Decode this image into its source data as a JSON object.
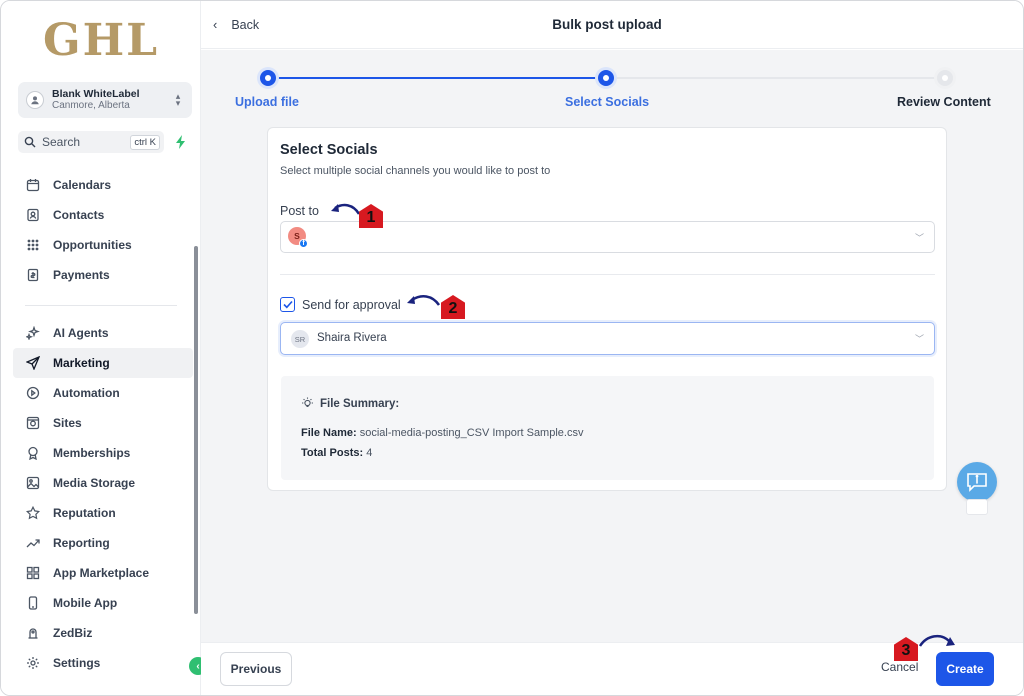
{
  "sidebar": {
    "logo": "GHL",
    "account": {
      "name": "Blank WhiteLabel",
      "location": "Canmore, Alberta"
    },
    "search": {
      "label": "Search",
      "shortcut": "ctrl K"
    },
    "items_top": [
      {
        "label": "Calendars",
        "icon": "calendar-icon"
      },
      {
        "label": "Contacts",
        "icon": "contacts-icon"
      },
      {
        "label": "Opportunities",
        "icon": "opportunities-icon"
      },
      {
        "label": "Payments",
        "icon": "payments-icon"
      }
    ],
    "items_bottom": [
      {
        "label": "AI Agents",
        "icon": "sparkle-icon"
      },
      {
        "label": "Marketing",
        "icon": "send-icon",
        "active": true
      },
      {
        "label": "Automation",
        "icon": "automation-icon"
      },
      {
        "label": "Sites",
        "icon": "sites-icon"
      },
      {
        "label": "Memberships",
        "icon": "memberships-icon"
      },
      {
        "label": "Media Storage",
        "icon": "image-icon"
      },
      {
        "label": "Reputation",
        "icon": "star-icon"
      },
      {
        "label": "Reporting",
        "icon": "trend-icon"
      },
      {
        "label": "App Marketplace",
        "icon": "grid-icon"
      },
      {
        "label": "Mobile App",
        "icon": "phone-icon"
      },
      {
        "label": "ZedBiz",
        "icon": "zedbiz-icon"
      },
      {
        "label": "Settings",
        "icon": "gear-icon"
      }
    ]
  },
  "header": {
    "back_label": "Back",
    "title": "Bulk post upload"
  },
  "stepper": {
    "steps": [
      {
        "label": "Upload file",
        "state": "done"
      },
      {
        "label": "Select Socials",
        "state": "current"
      },
      {
        "label": "Review Content",
        "state": "todo"
      }
    ]
  },
  "card": {
    "title": "Select Socials",
    "subtitle": "Select multiple social channels you would like to post to",
    "post_to_label": "Post to",
    "selected_account_initial": "S",
    "send_for_approval_label": "Send for approval",
    "send_for_approval_checked": true,
    "approver": {
      "initials": "SR",
      "name": "Shaira Rivera"
    },
    "summary": {
      "title": "File Summary:",
      "file_name_label": "File Name:",
      "file_name": "social-media-posting_CSV Import Sample.csv",
      "total_posts_label": "Total Posts:",
      "total_posts": "4"
    }
  },
  "footer": {
    "previous_label": "Previous",
    "cancel_label": "Cancel",
    "create_label": "Create"
  },
  "annotations": [
    "1",
    "2",
    "3"
  ],
  "colors": {
    "primary": "#1d56e8",
    "annotation_red": "#d71920",
    "annotation_arrow": "#1a237e",
    "logo_gold": "#b59a67"
  }
}
